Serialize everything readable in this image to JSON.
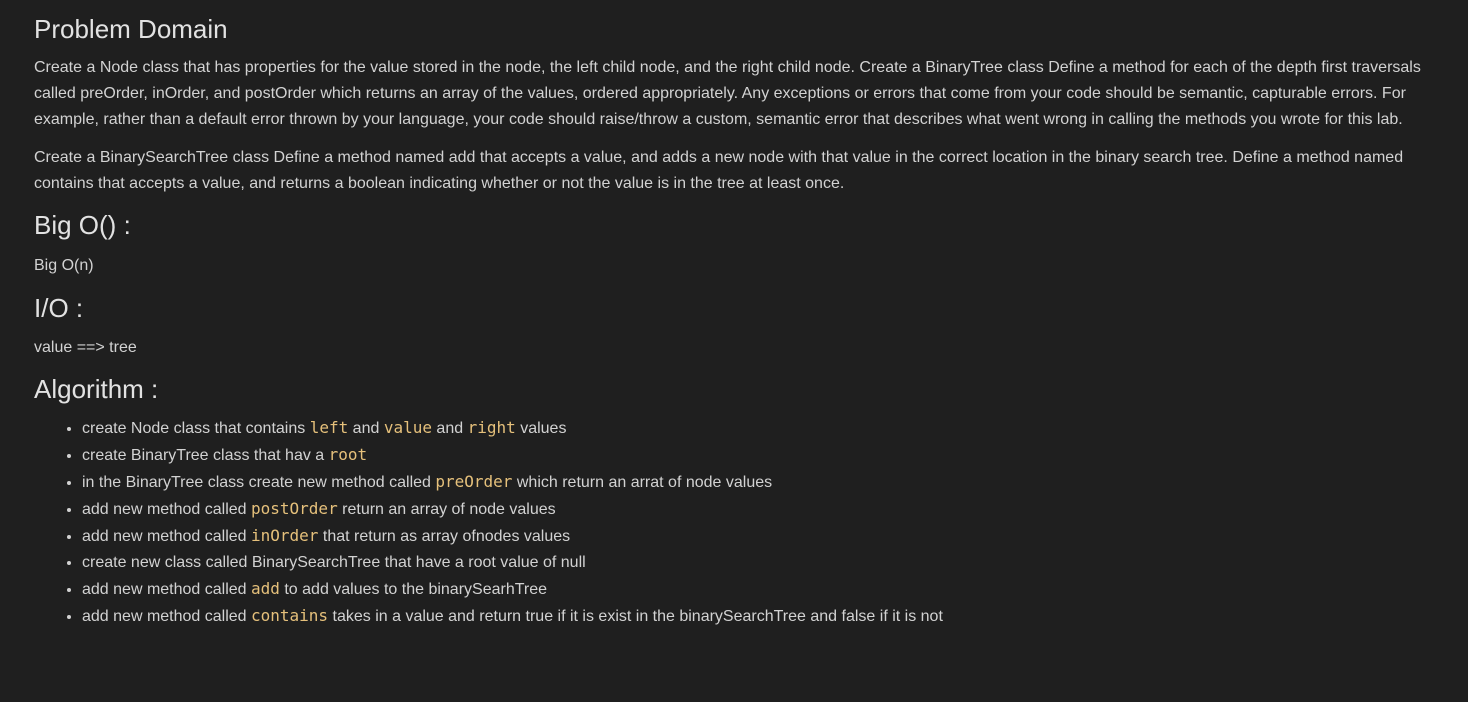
{
  "sections": {
    "problem": {
      "title": "Problem Domain",
      "paragraph1": "Create a Node class that has properties for the value stored in the node, the left child node, and the right child node. Create a BinaryTree class Define a method for each of the depth first traversals called preOrder, inOrder, and postOrder which returns an array of the values, ordered appropriately. Any exceptions or errors that come from your code should be semantic, capturable errors. For example, rather than a default error thrown by your language, your code should raise/throw a custom, semantic error that describes what went wrong in calling the methods you wrote for this lab.",
      "paragraph2": "Create a BinarySearchTree class Define a method named add that accepts a value, and adds a new node with that value in the correct location in the binary search tree. Define a method named contains that accepts a value, and returns a boolean indicating whether or not the value is in the tree at least once."
    },
    "bigo": {
      "title": "Big O() :",
      "text": "Big O(n)"
    },
    "io": {
      "title": "I/O :",
      "text": "value ==> tree"
    },
    "algorithm": {
      "title": "Algorithm :",
      "items": [
        {
          "t0": "create Node class that contains ",
          "c0": "left",
          "t1": " and ",
          "c1": "value",
          "t2": " and ",
          "c2": "right",
          "t3": " values"
        },
        {
          "t0": "create BinaryTree class that hav a ",
          "c0": "root"
        },
        {
          "t0": "in the BinaryTree class create new method called ",
          "c0": "preOrder",
          "t1": " which return an arrat of node values"
        },
        {
          "t0": "add new method called ",
          "c0": "postOrder",
          "t1": " return an array of node values"
        },
        {
          "t0": "add new method called ",
          "c0": "inOrder",
          "t1": " that return as array ofnodes values"
        },
        {
          "t0": "create new class called BinarySearchTree that have a root value of null"
        },
        {
          "t0": "add new method called ",
          "c0": "add",
          "t1": " to add values to the binarySearhTree"
        },
        {
          "t0": "add new method called ",
          "c0": "contains",
          "t1": " takes in a value and return true if it is exist in the binarySearchTree and false if it is not"
        }
      ]
    }
  },
  "colors": {
    "background": "#1f1f1f",
    "text": "#d2d2d2",
    "heading": "#e2e2e2",
    "code": "#e5c07b"
  }
}
